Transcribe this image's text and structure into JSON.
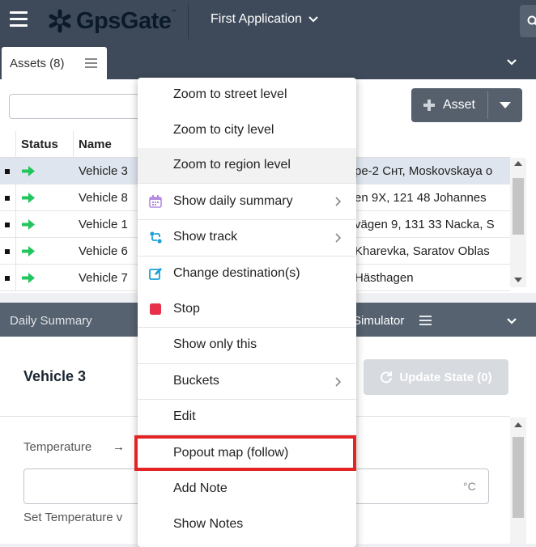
{
  "header": {
    "menu_icon": "hamburger-icon",
    "logo_text": "GpsGate",
    "logo_tm": "™",
    "app_title": "First Application",
    "search_icon": "search-icon"
  },
  "assets_panel": {
    "tab_label": "Assets (8)",
    "search_placeholder": "",
    "add_asset_label": "Asset",
    "columns": [
      "Status",
      "Name"
    ],
    "rows": [
      {
        "name": "Vehicle 3",
        "address": "pe-2 Снт, Moskovskaya o",
        "selected": true
      },
      {
        "name": "Vehicle 8",
        "address": "en 9X, 121 48 Johannes",
        "selected": false
      },
      {
        "name": "Vehicle 1",
        "address": "vägen 9, 131 33 Nacka, S",
        "selected": false
      },
      {
        "name": "Vehicle 6",
        "address": "Kharevka, Saratov Oblas",
        "selected": false
      },
      {
        "name": "Vehicle 7",
        "address": "Hästhagen",
        "selected": false
      }
    ],
    "status_color": "#22c55e"
  },
  "bottom_panel": {
    "tab_daily": "Daily Summary",
    "tab_simulator": "Simulator",
    "vehicle_title": "Vehicle 3",
    "update_state_label": "Update State (0)",
    "temperature_label": "Temperature",
    "temperature_arrow": "→",
    "temperature_value": "",
    "temperature_unit": "°C",
    "set_temperature_label": "Set Temperature v"
  },
  "context_menu": {
    "items": [
      {
        "label": "Zoom to street level",
        "icon": "",
        "submenu": false
      },
      {
        "label": "Zoom to city level",
        "icon": "",
        "submenu": false
      },
      {
        "label": "Zoom to region level",
        "icon": "",
        "submenu": false,
        "hover": true
      },
      {
        "label": "Show daily summary",
        "icon": "calendar-icon",
        "submenu": true
      },
      {
        "label": "Show track",
        "icon": "route-icon",
        "submenu": true
      },
      {
        "label": "Change destination(s)",
        "icon": "edit-icon",
        "submenu": false
      },
      {
        "label": "Stop",
        "icon": "stop-icon",
        "submenu": false
      },
      {
        "label": "Show only this",
        "icon": "",
        "submenu": false
      },
      {
        "label": "Buckets",
        "icon": "",
        "submenu": true
      },
      {
        "label": "Edit",
        "icon": "",
        "submenu": false
      },
      {
        "label": "Popout map (follow)",
        "icon": "",
        "submenu": false,
        "highlighted": true
      },
      {
        "label": "Add Note",
        "icon": "",
        "submenu": false
      },
      {
        "label": "Show Notes",
        "icon": "",
        "submenu": false
      }
    ],
    "highlight_color": "#e22424"
  }
}
